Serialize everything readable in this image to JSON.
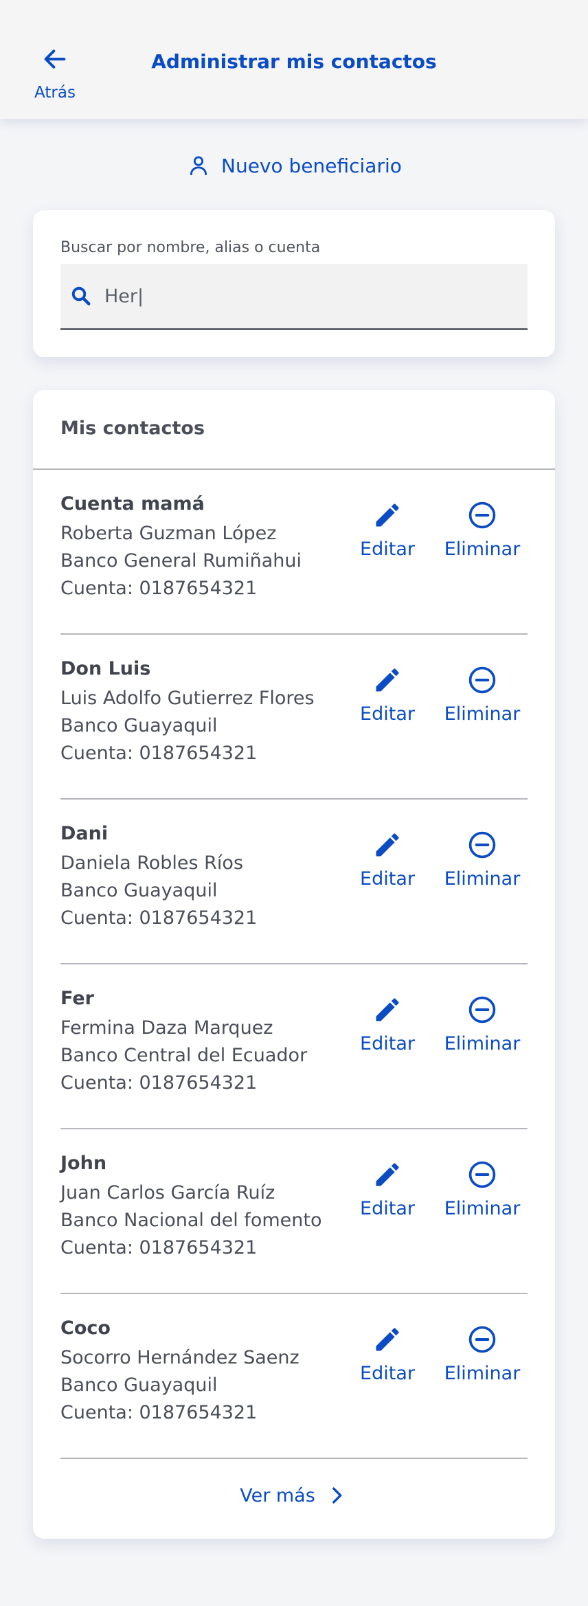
{
  "header": {
    "title": "Administrar mis contactos",
    "back_label": "Atrás"
  },
  "new_beneficiary_label": "Nuevo beneficiario",
  "search": {
    "label": "Buscar por nombre, alias o cuenta",
    "value": "Her|"
  },
  "contacts": {
    "title": "Mis contactos",
    "edit_label": "Editar",
    "delete_label": "Eliminar",
    "items": [
      {
        "alias": "Cuenta mamá",
        "name": "Roberta Guzman López",
        "bank": "Banco General Rumiñahui",
        "account": "Cuenta: 0187654321"
      },
      {
        "alias": "Don Luis",
        "name": "Luis Adolfo Gutierrez Flores",
        "bank": "Banco Guayaquil",
        "account": "Cuenta: 0187654321"
      },
      {
        "alias": "Dani",
        "name": "Daniela Robles Ríos",
        "bank": "Banco Guayaquil",
        "account": "Cuenta: 0187654321"
      },
      {
        "alias": "Fer",
        "name": "Fermina Daza Marquez",
        "bank": "Banco Central del Ecuador",
        "account": "Cuenta: 0187654321"
      },
      {
        "alias": "John",
        "name": "Juan Carlos García Ruíz",
        "bank": "Banco Nacional del fomento",
        "account": "Cuenta: 0187654321"
      },
      {
        "alias": "Coco",
        "name": "Socorro Hernández Saenz",
        "bank": "Banco Guayaquil",
        "account": "Cuenta: 0187654321"
      }
    ],
    "see_more_label": "Ver más"
  },
  "colors": {
    "accent": "#0b4cc4",
    "background": "#f4f5f7",
    "text": "#40444f"
  },
  "icons": {
    "back": "arrow-left-icon",
    "person": "person-icon",
    "search": "search-icon",
    "edit": "pencil-icon",
    "delete": "minus-circle-icon",
    "more": "chevron-right-icon"
  }
}
